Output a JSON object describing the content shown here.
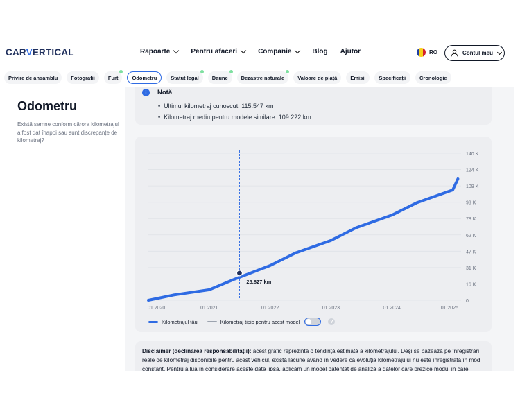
{
  "header": {
    "logo_part1": "CAR",
    "logo_part2": "V",
    "logo_part3": "ERTICAL",
    "nav": [
      {
        "label": "Rapoarte",
        "dropdown": true
      },
      {
        "label": "Pentru afaceri",
        "dropdown": true
      },
      {
        "label": "Companie",
        "dropdown": true
      },
      {
        "label": "Blog",
        "dropdown": false
      },
      {
        "label": "Ajutor",
        "dropdown": false
      }
    ],
    "language": "RO",
    "account_label": "Contul meu"
  },
  "tabs": [
    {
      "label": "Privire de ansamblu",
      "dot": false,
      "active": false
    },
    {
      "label": "Fotografii",
      "dot": false,
      "active": false
    },
    {
      "label": "Furt",
      "dot": true,
      "active": false
    },
    {
      "label": "Odometru",
      "dot": false,
      "active": true
    },
    {
      "label": "Statut legal",
      "dot": true,
      "active": false
    },
    {
      "label": "Daune",
      "dot": true,
      "active": false
    },
    {
      "label": "Dezastre naturale",
      "dot": true,
      "active": false
    },
    {
      "label": "Valoare de piață",
      "dot": false,
      "active": false
    },
    {
      "label": "Emisii",
      "dot": false,
      "active": false
    },
    {
      "label": "Specificații",
      "dot": false,
      "active": false
    },
    {
      "label": "Cronologie",
      "dot": false,
      "active": false
    }
  ],
  "sidebar": {
    "title": "Odometru",
    "description": "Există semne conform cărora kilometrajul a fost dat înapoi sau sunt discrepanțe de kilometraj?"
  },
  "note": {
    "title": "Notă",
    "items": [
      "Ultimul kilometraj cunoscut: 115.547 km",
      "Kilometraj mediu pentru modele similare: 109.222 km"
    ]
  },
  "chart_data": {
    "type": "line",
    "x_ticks": [
      "01.2020",
      "01.2021",
      "01.2022",
      "01.2023",
      "01.2024",
      "01.2025"
    ],
    "y_ticks": [
      "0",
      "16 K",
      "31 K",
      "47 K",
      "62 K",
      "78 K",
      "93 K",
      "109 K",
      "124 K",
      "140 K"
    ],
    "ylim": [
      0,
      140000
    ],
    "series": [
      {
        "name": "Kilometrajul tău",
        "color": "#2f6be3",
        "x": [
          "2020-01",
          "2020-06",
          "2021-01",
          "2021-06",
          "2022-01",
          "2022-06",
          "2023-01",
          "2023-06",
          "2024-01",
          "2024-06",
          "2025-01",
          "2025-02"
        ],
        "values": [
          0,
          5000,
          10000,
          20000,
          33000,
          45000,
          57000,
          69000,
          81000,
          93000,
          105000,
          115547
        ]
      }
    ],
    "marker": {
      "x": "2021-07",
      "value": 25827,
      "label": "25.827 km"
    },
    "legend": [
      {
        "label": "Kilometrajul tău",
        "color": "#2f6be3"
      },
      {
        "label": "Kilometraj tipic pentru acest model",
        "color": "#9ca3af"
      }
    ]
  },
  "disclaimer": {
    "title": "Disclaimer (declinarea responsabilității):",
    "text": " acest grafic reprezintă o tendință estimată a kilometrajului. Deși se bazează pe înregistrări reale de kilometraj disponibile pentru acest vehicul, există lacune având în vedere că evoluția kilometrajului nu este înregistrată în mod constant. Pentru a lua în considerare aceste date lipsă, aplicăm un model patentat de analiză a datelor care prezice modul în care"
  }
}
